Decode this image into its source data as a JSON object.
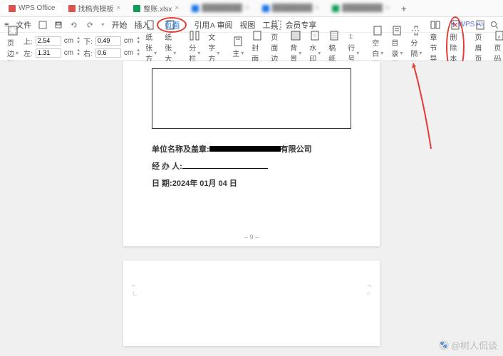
{
  "tabs": {
    "items": [
      {
        "icon": "wps",
        "icon_color": "#d9534f",
        "label": "WPS Office"
      },
      {
        "icon": "doc",
        "icon_color": "#d9534f",
        "label": "找稿壳模板"
      },
      {
        "icon": "xls",
        "icon_color": "#0f9d58",
        "label": "整账.xlsx"
      },
      {
        "icon": "doc",
        "icon_color": "#1a73e8",
        "label": "████████",
        "blurred": true
      },
      {
        "icon": "doc",
        "icon_color": "#1a73e8",
        "label": "████████",
        "blurred": true
      },
      {
        "icon": "xls",
        "icon_color": "#0f9d58",
        "label": "████████",
        "blurred": true
      }
    ],
    "add": "+"
  },
  "menubar": {
    "file": "文件",
    "items": [
      "开始",
      "插入",
      "页面",
      "引用",
      "审阅",
      "视图",
      "工具",
      "会员专享"
    ],
    "selected_index": 2,
    "wpsai": "WPS AI"
  },
  "ribbon": {
    "margins_btn": "页边距",
    "margins": {
      "top_label": "上:",
      "top_value": "2.54",
      "top_unit": "cm",
      "bottom_label": "下:",
      "bottom_value": "0.49",
      "bottom_unit": "cm",
      "left_label": "左:",
      "left_value": "1.31",
      "left_unit": "cm",
      "right_label": "右:",
      "right_value": "0.6",
      "right_unit": "cm"
    },
    "orientation": "纸张方向",
    "size": "纸张大小",
    "columns": "分栏",
    "direction": "文字方向",
    "master": "主",
    "cover": "封面",
    "page_border": "页面边框",
    "background": "背景",
    "watermark": "水印",
    "lined_paper": "稿纸",
    "line_number": "行号",
    "blank_page": "空白页",
    "toc_page": "目录页",
    "page_break": "分隔符",
    "chapter_nav": "章节导航",
    "delete_section": "删除本节",
    "header_footer": "页眉页脚",
    "page_number": "页码"
  },
  "document": {
    "seal_label": "单位名称及盖章:",
    "seal_suffix": "有限公司",
    "handler_label": "经 办 人:",
    "date_label": "日    期:",
    "date_value": "2024年 01月 04 日",
    "page_number": "– 9 –"
  },
  "watermark_text": "@树人侃谈"
}
